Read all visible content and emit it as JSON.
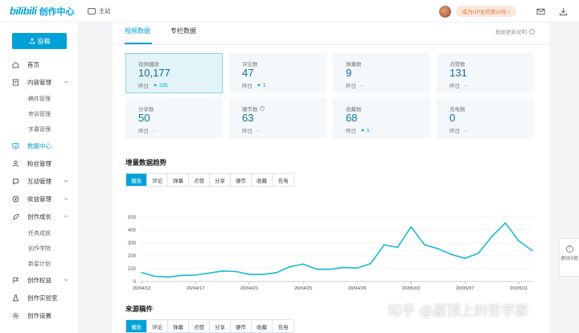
{
  "header": {
    "logo_text": "bilibili",
    "logo_title": "创作中心",
    "home_link": "主站",
    "upgrade_badge": "成为UP主的第33天 ›",
    "icons": [
      "mail-icon",
      "download-icon"
    ]
  },
  "sidebar": {
    "post_button": "投稿",
    "items": [
      {
        "label": "首页",
        "icon": "home-icon"
      },
      {
        "label": "内容管理",
        "icon": "content-icon",
        "expanded": true
      },
      {
        "label": "稿件管理",
        "sub": true
      },
      {
        "label": "申诉管理",
        "sub": true
      },
      {
        "label": "字幕管理",
        "sub": true
      },
      {
        "label": "数据中心",
        "icon": "data-icon",
        "active": true
      },
      {
        "label": "粉丝管理",
        "icon": "fans-icon"
      },
      {
        "label": "互动管理",
        "icon": "interact-icon"
      },
      {
        "label": "收益管理",
        "icon": "income-icon"
      },
      {
        "label": "创作成长",
        "icon": "growth-icon",
        "expanded": true
      },
      {
        "label": "任务成就",
        "sub": true
      },
      {
        "label": "创作学院",
        "sub": true
      },
      {
        "label": "新星计划",
        "sub": true
      },
      {
        "label": "创作权益",
        "icon": "rights-icon"
      },
      {
        "label": "创作实验室",
        "icon": "lab-icon"
      },
      {
        "label": "创作设置",
        "icon": "settings-icon"
      }
    ]
  },
  "main": {
    "tabs": [
      "视频数据",
      "专栏数据"
    ],
    "active_tab": 0,
    "help_text": "数据更新说明",
    "yesterday_label": "昨日",
    "stats": [
      {
        "label": "视频播放",
        "value": "10,177",
        "delta": "235",
        "selected": true
      },
      {
        "label": "评论数",
        "value": "47",
        "delta": "1"
      },
      {
        "label": "弹幕数",
        "value": "9",
        "delta": "--"
      },
      {
        "label": "点赞数",
        "value": "131",
        "delta": "--"
      },
      {
        "label": "分享数",
        "value": "50",
        "delta": "--"
      },
      {
        "label": "硬币数",
        "value": "63",
        "delta": "--",
        "help": true
      },
      {
        "label": "收藏数",
        "value": "68",
        "delta": "1"
      },
      {
        "label": "充电数",
        "value": "0",
        "delta": "--"
      }
    ],
    "trend_title": "增量数据趋势",
    "metric_tabs": [
      "播放",
      "评论",
      "弹幕",
      "点赞",
      "分享",
      "硬币",
      "收藏",
      "充电"
    ],
    "active_metric": 0,
    "source_title": "来源稿件"
  },
  "float_button": {
    "label": "遇到问题"
  },
  "watermark": "知乎 @屋顶上的哲学家",
  "chart_data": {
    "type": "line",
    "title": "",
    "xlabel": "",
    "ylabel": "",
    "ylim": [
      0,
      500
    ],
    "yticks": [
      0,
      100,
      200,
      300,
      400,
      500
    ],
    "x": [
      "20/04/13",
      "20/04/14",
      "20/04/15",
      "20/04/16",
      "20/04/17",
      "20/04/18",
      "20/04/19",
      "20/04/20",
      "20/04/21",
      "20/04/22",
      "20/04/23",
      "20/04/24",
      "20/04/25",
      "20/04/26",
      "20/04/27",
      "20/04/28",
      "20/04/29",
      "20/04/30",
      "20/05/01",
      "20/05/02",
      "20/05/03",
      "20/05/04",
      "20/05/05",
      "20/05/06",
      "20/05/07",
      "20/05/08",
      "20/05/09",
      "20/05/10",
      "20/05/11",
      "20/05/12"
    ],
    "xtick_labels": [
      "20/04/13",
      "20/04/17",
      "20/04/21",
      "20/04/25",
      "20/04/29",
      "20/05/03",
      "20/05/07",
      "20/05/11"
    ],
    "xtick_indices": [
      0,
      4,
      8,
      12,
      16,
      20,
      24,
      28
    ],
    "values": [
      70,
      40,
      35,
      48,
      50,
      65,
      82,
      78,
      55,
      55,
      68,
      115,
      135,
      95,
      95,
      110,
      105,
      140,
      285,
      265,
      425,
      285,
      255,
      210,
      180,
      220,
      350,
      455,
      315,
      240
    ],
    "color": "#1cb8d4",
    "grid": true
  }
}
